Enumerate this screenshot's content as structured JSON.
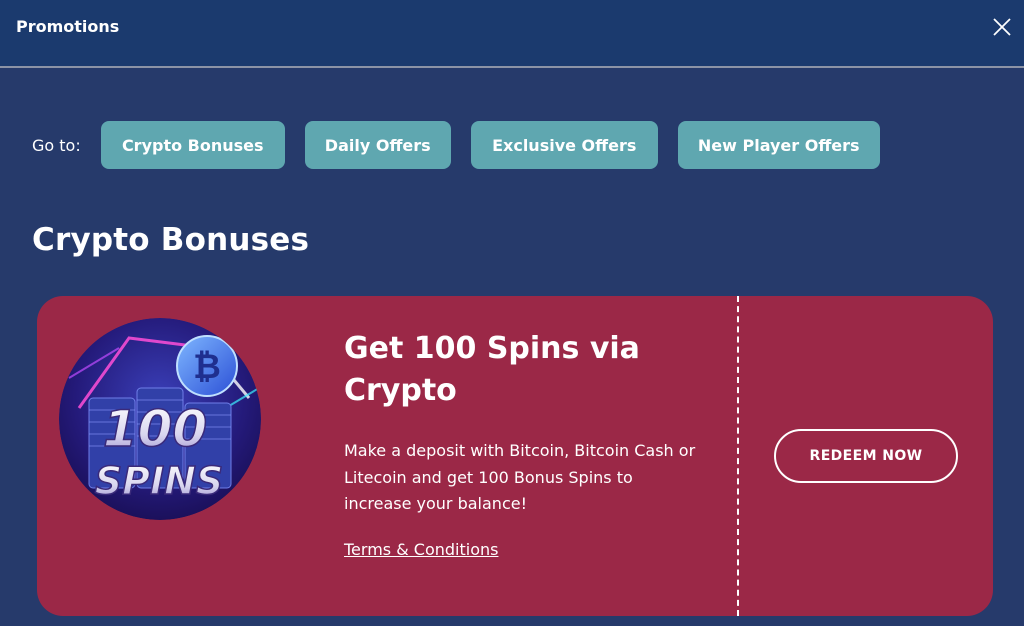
{
  "window": {
    "title": "Promotions",
    "close_icon": "close-icon"
  },
  "goto": {
    "label": "Go to:",
    "buttons": [
      {
        "label": "Crypto Bonuses"
      },
      {
        "label": "Daily Offers"
      },
      {
        "label": "Exclusive Offers"
      },
      {
        "label": "New Player Offers"
      }
    ]
  },
  "section": {
    "title": "Crypto Bonuses"
  },
  "promo": {
    "image_text_number": "100",
    "image_text_word": "SPINS",
    "heading": "Get 100 Spins via Crypto",
    "description": "Make a deposit with Bitcoin, Bitcoin Cash or Litecoin and get 100 Bonus Spins to increase your balance!",
    "terms_label": "Terms & Conditions",
    "redeem_label": "REDEEM NOW"
  },
  "colors": {
    "page_background": "#263a6b",
    "titlebar": "#1b3a6e",
    "goto_button": "#5fa7b0",
    "card": "#9b2847"
  }
}
